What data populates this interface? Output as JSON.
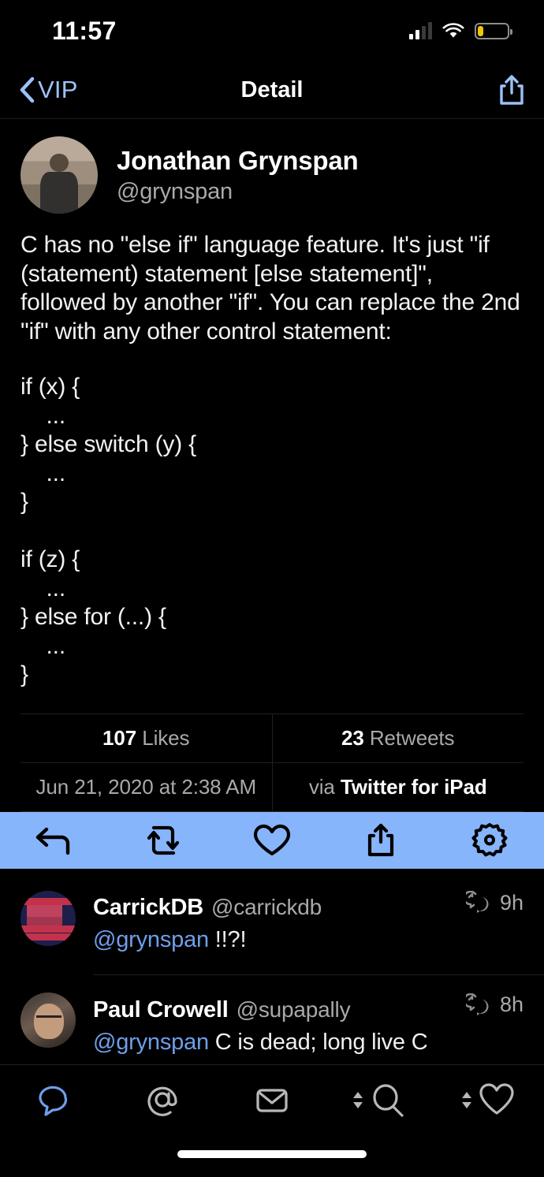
{
  "status_bar": {
    "time": "11:57",
    "signal_bars_filled": 2,
    "signal_bars_total": 4,
    "wifi": "wifi-icon",
    "battery_percent": 20,
    "battery_color": "#f2c409"
  },
  "nav": {
    "back_label": "VIP",
    "title": "Detail",
    "back_icon": "chevron-left-icon",
    "share_icon": "share-icon",
    "tint_color": "#9dc1f7"
  },
  "tweet": {
    "author_name": "Jonathan Grynspan",
    "author_handle": "@grynspan",
    "avatar": "avatar-jonathan-grynspan",
    "body": "C has no \"else if\" language feature. It's just \"if (statement) statement [else statement]\", followed by another \"if\". You can replace the 2nd \"if\" with any other control statement:",
    "code": "if (x) {\n    ...\n} else switch (y) {\n    ...\n}\n\nif (z) {\n    ...\n} else for (...) {\n    ...\n}",
    "likes_count": "107",
    "likes_label": "Likes",
    "retweets_count": "23",
    "retweets_label": "Retweets",
    "timestamp": "Jun 21, 2020 at 2:38 AM",
    "via_prefix": "via",
    "via_source": "Twitter for iPad"
  },
  "action_bar": {
    "background": "#87b5fb",
    "actions": [
      {
        "name": "reply-icon",
        "label": "Reply"
      },
      {
        "name": "retweet-icon",
        "label": "Retweet"
      },
      {
        "name": "heart-icon",
        "label": "Like"
      },
      {
        "name": "share-icon",
        "label": "Share"
      },
      {
        "name": "gear-icon",
        "label": "More"
      }
    ]
  },
  "replies": [
    {
      "name": "CarrickDB",
      "handle": "@carrickdb",
      "avatar": "avatar-carrickdb",
      "mention": "@grynspan",
      "text": " !!?!",
      "time": "9h",
      "conversation_icon": "conversation-reply-icon"
    },
    {
      "name": "Paul Crowell",
      "handle": "@supapally",
      "avatar": "avatar-paul-crowell",
      "mention": "@grynspan",
      "text": " C is dead; long live C",
      "time": "8h",
      "conversation_icon": "conversation-reply-icon"
    }
  ],
  "tab_bar": {
    "items": [
      {
        "name": "tab-timeline",
        "icon": "speech-bubble-icon",
        "active": true,
        "stepper": false
      },
      {
        "name": "tab-mentions",
        "icon": "at-sign-icon",
        "active": false,
        "stepper": false
      },
      {
        "name": "tab-messages",
        "icon": "envelope-icon",
        "active": false,
        "stepper": false
      },
      {
        "name": "tab-search",
        "icon": "magnifier-icon",
        "active": false,
        "stepper": true
      },
      {
        "name": "tab-likes",
        "icon": "heart-outline-icon",
        "active": false,
        "stepper": true
      }
    ],
    "active_color": "#6f9eeb",
    "inactive_color": "#b8b8b8"
  }
}
